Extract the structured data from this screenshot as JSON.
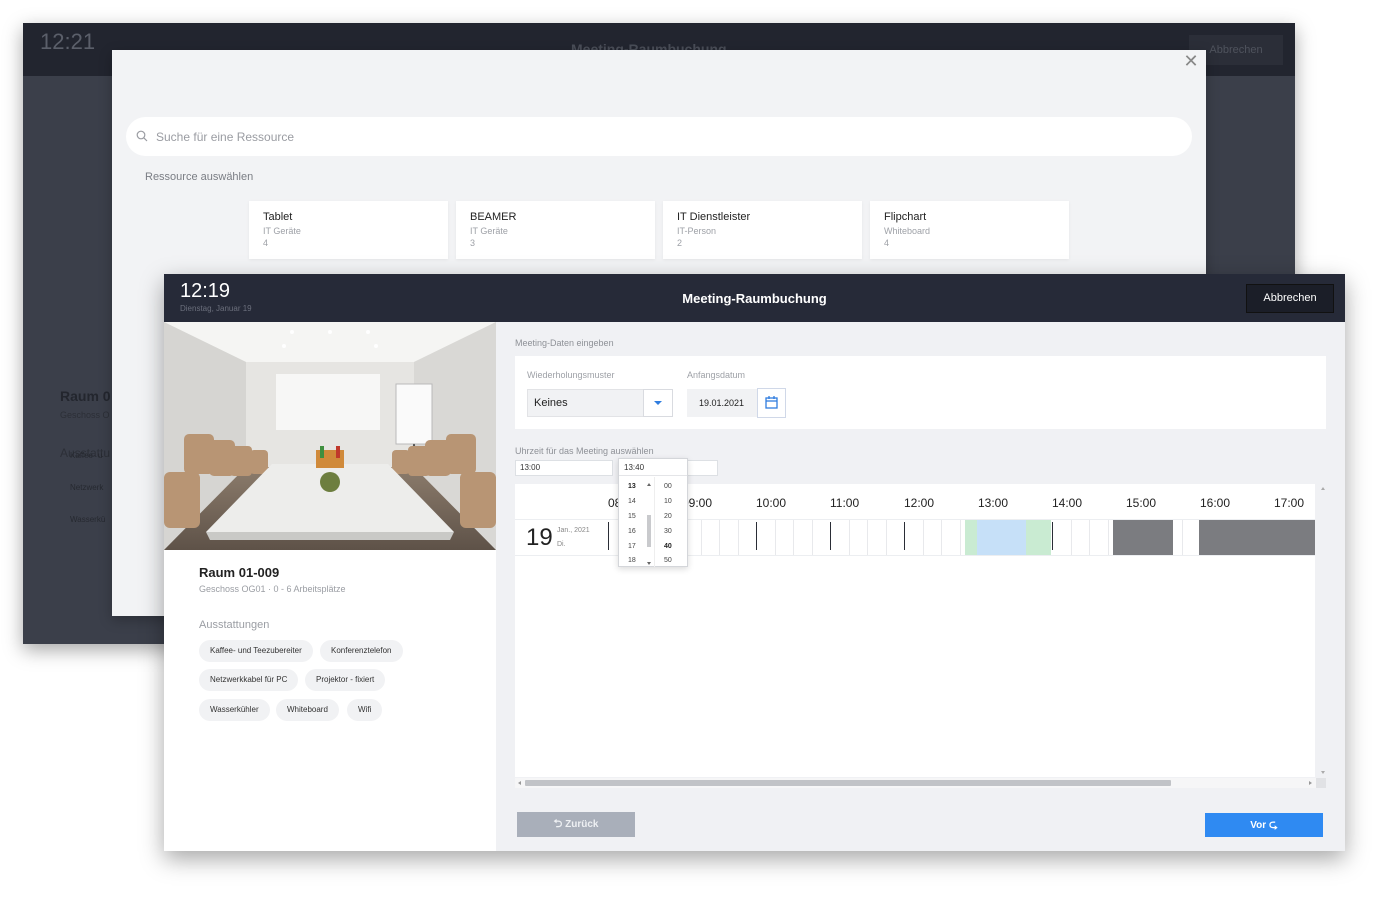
{
  "back_window": {
    "time": "12:21",
    "title": "Meeting-Raumbuchung",
    "cancel_label": "Abbrechen",
    "room_name": "Raum 0",
    "floor_partial": "Geschoss O",
    "amenities_label": "Ausstattu",
    "chips": [
      "Kaffee- u",
      "Netzwerk",
      "Wasserkü"
    ]
  },
  "resource_modal": {
    "search_placeholder": "Suche für eine Ressource",
    "section_label": "Ressource auswählen",
    "resources": [
      {
        "name": "Tablet",
        "category": "IT Geräte",
        "count": "4"
      },
      {
        "name": "BEAMER",
        "category": "IT Geräte",
        "count": "3"
      },
      {
        "name": "IT Dienstleister",
        "category": "IT-Person",
        "count": "2"
      },
      {
        "name": "Flipchart",
        "category": "Whiteboard",
        "count": "4"
      }
    ]
  },
  "front_window": {
    "time": "12:19",
    "date": "Dienstag, Januar 19",
    "title": "Meeting-Raumbuchung",
    "cancel_label": "Abbrechen",
    "room": {
      "name": "Raum 01-009",
      "subtitle": "Geschoss OG01  ·  0 - 6 Arbeitsplätze",
      "amenities_label": "Ausstattungen",
      "amenities": [
        "Kaffee- und Teezubereiter",
        "Konferenztelefon",
        "Netzwerkkabel für PC",
        "Projektor - fixiert",
        "Wasserkühler",
        "Whiteboard",
        "Wifi"
      ]
    },
    "form": {
      "section_label": "Meeting-Daten eingeben",
      "recurrence_label": "Wiederholungsmuster",
      "recurrence_value": "Keines",
      "start_label": "Anfangsdatum",
      "start_value": "19.01.2021"
    },
    "time_section": {
      "label": "Uhrzeit für das Meeting auswählen",
      "from_value": "13:00",
      "to_value": "13:40"
    },
    "time_picker": {
      "hours": [
        "13",
        "14",
        "15",
        "16",
        "17",
        "18"
      ],
      "minutes": [
        "00",
        "10",
        "20",
        "30",
        "40",
        "50"
      ],
      "selected_hour": "13",
      "selected_minute": "40"
    },
    "timeline": {
      "hours": [
        "08:00",
        "09:00",
        "10:00",
        "11:00",
        "12:00",
        "13:00",
        "14:00",
        "15:00",
        "16:00",
        "17:00"
      ],
      "day": {
        "number": "19",
        "month": "Jan., 2021",
        "dow": "Di."
      },
      "colors": {
        "selected": "#c6e0f8",
        "buffer": "#c9ebd2",
        "booked": "#7b7c80"
      }
    },
    "buttons": {
      "back": "Zurück",
      "next": "Vor"
    }
  }
}
